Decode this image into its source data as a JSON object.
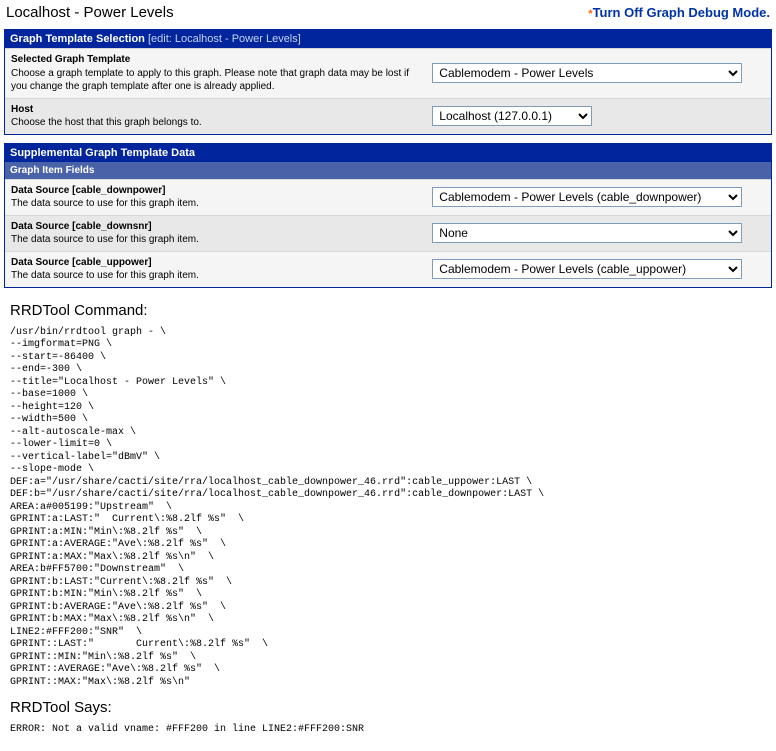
{
  "header": {
    "title": "Localhost - Power Levels",
    "debug_link": "Turn Off Graph Debug Mode."
  },
  "panel1": {
    "title": "Graph Template Selection",
    "edit": "[edit: Localhost - Power Levels]",
    "rows": [
      {
        "title": "Selected Graph Template",
        "desc": "Choose a graph template to apply to this graph. Please note that graph data may be lost if you change the graph template after one is already applied.",
        "value": "Cablemodem - Power Levels",
        "select_class": "wide"
      },
      {
        "title": "Host",
        "desc": "Choose the host that this graph belongs to.",
        "value": "Localhost (127.0.0.1)",
        "select_class": "med"
      }
    ]
  },
  "panel2": {
    "title": "Supplemental Graph Template Data",
    "subheader": "Graph Item Fields",
    "rows": [
      {
        "title": "Data Source [cable_downpower]",
        "desc": "The data source to use for this graph item.",
        "value": "Cablemodem - Power Levels (cable_downpower)",
        "select_class": "wide"
      },
      {
        "title": "Data Source [cable_downsnr]",
        "desc": "The data source to use for this graph item.",
        "value": "None",
        "select_class": "wide"
      },
      {
        "title": "Data Source [cable_uppower]",
        "desc": "The data source to use for this graph item.",
        "value": "Cablemodem - Power Levels (cable_uppower)",
        "select_class": "wide"
      }
    ]
  },
  "rrd": {
    "cmd_heading": "RRDTool Command:",
    "cmd": "/usr/bin/rrdtool graph - \\\n--imgformat=PNG \\\n--start=-86400 \\\n--end=-300 \\\n--title=\"Localhost - Power Levels\" \\\n--base=1000 \\\n--height=120 \\\n--width=500 \\\n--alt-autoscale-max \\\n--lower-limit=0 \\\n--vertical-label=\"dBmV\" \\\n--slope-mode \\\nDEF:a=\"/usr/share/cacti/site/rra/localhost_cable_downpower_46.rrd\":cable_uppower:LAST \\\nDEF:b=\"/usr/share/cacti/site/rra/localhost_cable_downpower_46.rrd\":cable_downpower:LAST \\\nAREA:a#005199:\"Upstream\"  \\\nGPRINT:a:LAST:\"  Current\\:%8.2lf %s\"  \\\nGPRINT:a:MIN:\"Min\\:%8.2lf %s\"  \\\nGPRINT:a:AVERAGE:\"Ave\\:%8.2lf %s\"  \\\nGPRINT:a:MAX:\"Max\\:%8.2lf %s\\n\"  \\\nAREA:b#FF5700:\"Downstream\"  \\\nGPRINT:b:LAST:\"Current\\:%8.2lf %s\"  \\\nGPRINT:b:MIN:\"Min\\:%8.2lf %s\"  \\\nGPRINT:b:AVERAGE:\"Ave\\:%8.2lf %s\"  \\\nGPRINT:b:MAX:\"Max\\:%8.2lf %s\\n\"  \\\nLINE2:#FFF200:\"SNR\"  \\\nGPRINT::LAST:\"       Current\\:%8.2lf %s\"  \\\nGPRINT::MIN:\"Min\\:%8.2lf %s\"  \\\nGPRINT::AVERAGE:\"Ave\\:%8.2lf %s\"  \\\nGPRINT::MAX:\"Max\\:%8.2lf %s\\n\" ",
    "says_heading": "RRDTool Says:",
    "says": "ERROR: Not a valid vname: #FFF200 in line LINE2:#FFF200:SNR"
  }
}
